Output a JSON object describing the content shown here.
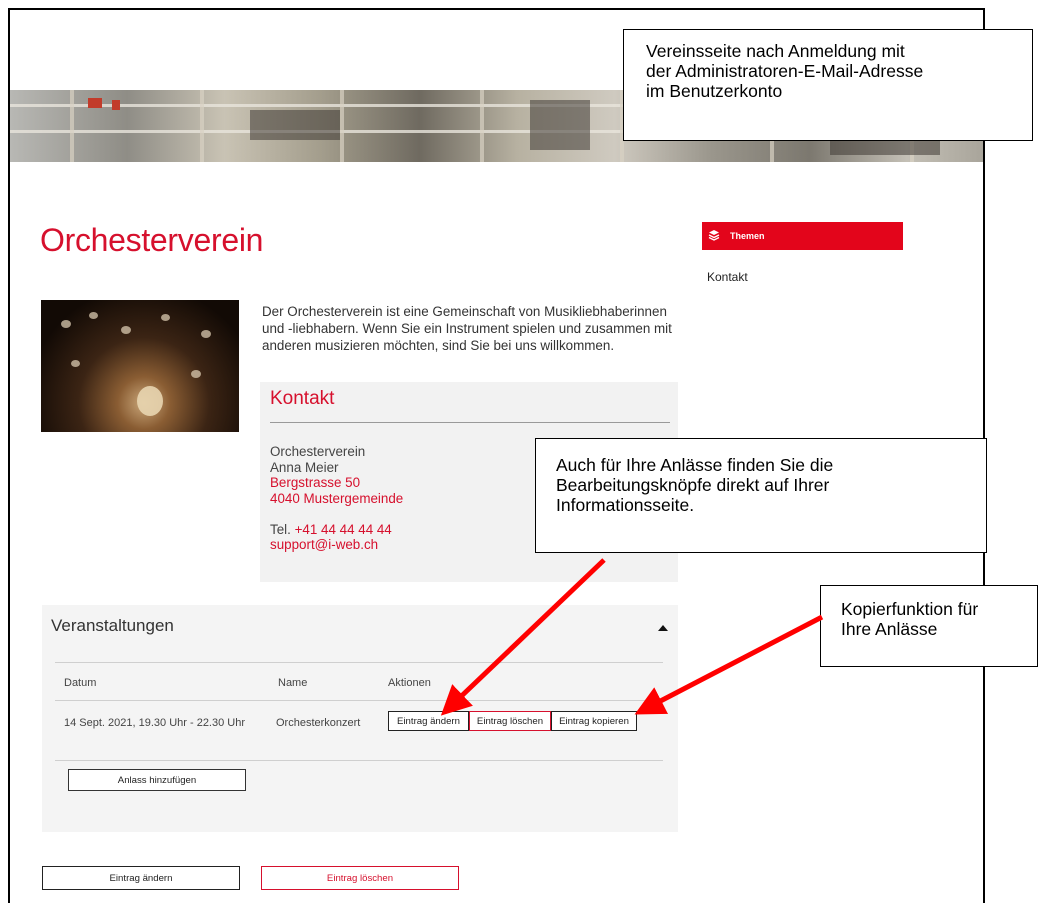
{
  "page": {
    "title": "Orchesterverein",
    "intro": "Der Orchesterverein ist eine Gemeinschaft von Musikliebhaberinnen und -liebhabern. Wenn Sie ein Instrument spielen und zusammen mit anderen musizieren möchten, sind Sie bei uns willkommen."
  },
  "contact": {
    "heading": "Kontakt",
    "name": "Orchesterverein",
    "person": "Anna Meier",
    "street": "Bergstrasse 50",
    "city": "4040 Mustergemeinde",
    "tel_label": "Tel.",
    "tel": "+41 44 44 44 44",
    "email": "support@i-web.ch"
  },
  "sidebar": {
    "header": "Themen",
    "link": "Kontakt"
  },
  "events": {
    "title": "Veranstaltungen",
    "columns": [
      "Datum",
      "Name",
      "Aktionen"
    ],
    "rows": [
      {
        "date": "14 Sept. 2021, 19.30 Uhr - 22.30 Uhr",
        "name": "Orchesterkonzert",
        "edit": "Eintrag ändern",
        "delete": "Eintrag löschen",
        "copy": "Eintrag kopieren"
      }
    ],
    "add_button": "Anlass hinzufügen"
  },
  "footer_buttons": {
    "edit": "Eintrag ändern",
    "delete": "Eintrag löschen"
  },
  "annotations": {
    "top": "Vereinsseite nach Anmeldung mit\nder Administratoren-E-Mail-Adresse\nim Benutzerkonto",
    "middle": "Auch für Ihre Anlässe finden Sie die\nBearbeitungsknöpfe direkt auf Ihrer\nInformationsseite.",
    "right": "Kopierfunktion für\nIhre Anlässe"
  },
  "colors": {
    "accent": "#d6102d",
    "sidebar_header": "#e3051b",
    "arrow": "#ff0000"
  }
}
